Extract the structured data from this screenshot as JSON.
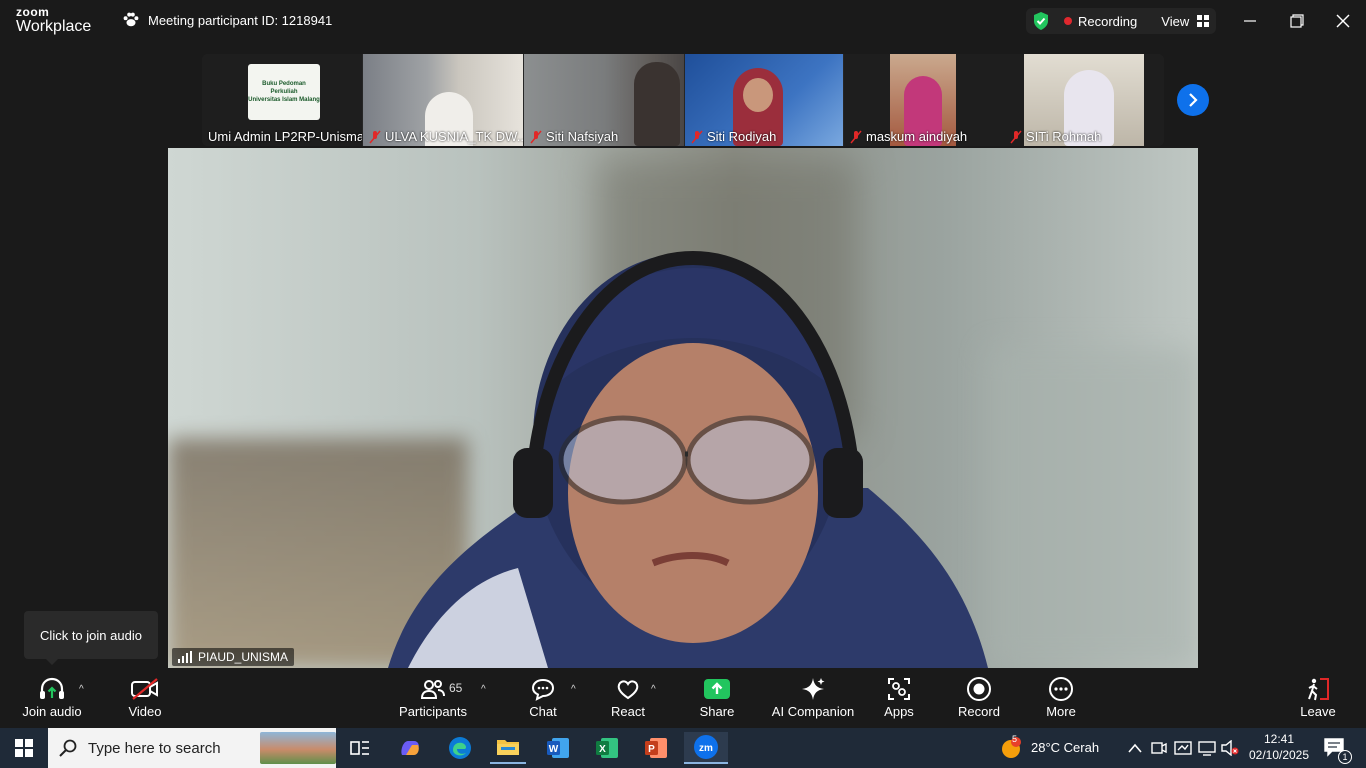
{
  "titlebar": {
    "logo_top": "zoom",
    "logo_bottom": "Workplace",
    "meeting_id": "Meeting participant ID: 1218941",
    "recording_label": "Recording",
    "view_label": "View"
  },
  "thumbnails": [
    {
      "name": "Umi Admin LP2RP-Unisma",
      "muted": false,
      "slide_line1": "Buku Pedoman Perkuliah",
      "slide_line2": "Universitas Islam Malang"
    },
    {
      "name": "ULVA KUSNIA_TK DW...",
      "muted": true
    },
    {
      "name": "Siti Nafsiyah",
      "muted": true
    },
    {
      "name": "Siti Rodiyah",
      "muted": true
    },
    {
      "name": "maskum aindiyah",
      "muted": true
    },
    {
      "name": "SITi Rohmah",
      "muted": true
    }
  ],
  "main_video": {
    "speaker_label": "PIAUD_UNISMA"
  },
  "tooltip": "Click to join audio",
  "toolbar": {
    "join_audio": "Join audio",
    "video": "Video",
    "participants": "Participants",
    "participants_count": "65",
    "chat": "Chat",
    "react": "React",
    "share": "Share",
    "ai_companion": "AI Companion",
    "apps": "Apps",
    "record": "Record",
    "more": "More",
    "leave": "Leave"
  },
  "taskbar": {
    "search_placeholder": "Type here to search",
    "weather_badge": "5",
    "weather": "28°C  Cerah",
    "time": "12:41",
    "date": "02/10/2025",
    "notification_count": "1"
  },
  "colors": {
    "accent_blue": "#0e71eb",
    "share_green": "#22c55e",
    "recording_red": "#e0282e",
    "muted_red": "#e02828"
  }
}
